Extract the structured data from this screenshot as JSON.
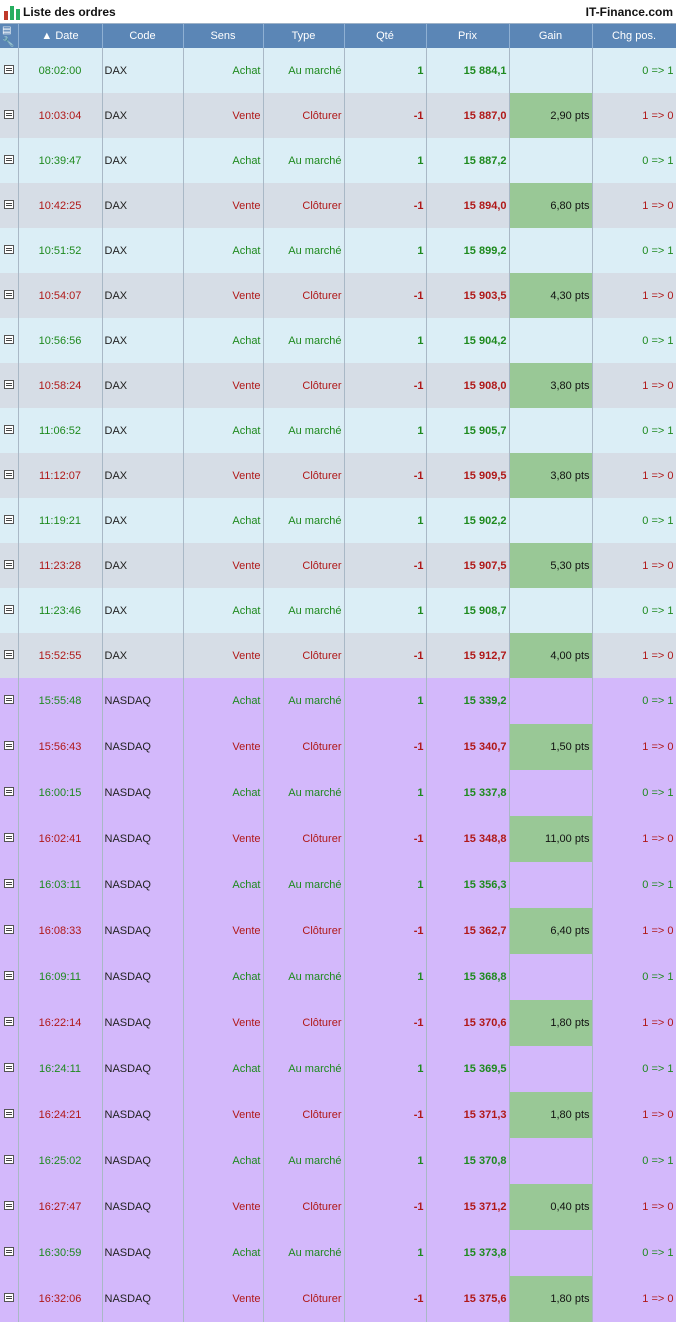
{
  "window": {
    "title": "Liste des ordres",
    "brand": "IT-Finance.com"
  },
  "icons": {
    "app": "candlestick-chart-icon",
    "header_doc": "document-icon",
    "header_tool": "wrench-icon",
    "sort": "sort-up-arrow-icon",
    "row": "order-detail-icon"
  },
  "colors": {
    "buy": "#1e8a1e",
    "sell": "#b01818",
    "gain_bg": "#99c896",
    "header_bg": "#5b86b6",
    "dax_row": "#dbeef6",
    "dax_row_alt": "#d6dde6",
    "nasdaq_row": "#d3b8fb"
  },
  "columns": {
    "date": "Date",
    "code": "Code",
    "sens": "Sens",
    "type": "Type",
    "qte": "Qté",
    "prix": "Prix",
    "gain": "Gain",
    "chg": "Chg pos."
  },
  "orders": [
    {
      "date": "08:02:00",
      "code": "DAX",
      "sens": "Achat",
      "type": "Au marché",
      "qte": "1",
      "prix": "15 884,1",
      "gain": "",
      "chg": "0 => 1"
    },
    {
      "date": "10:03:04",
      "code": "DAX",
      "sens": "Vente",
      "type": "Clôturer",
      "qte": "-1",
      "prix": "15 887,0",
      "gain": "2,90 pts",
      "chg": "1 => 0"
    },
    {
      "date": "10:39:47",
      "code": "DAX",
      "sens": "Achat",
      "type": "Au marché",
      "qte": "1",
      "prix": "15 887,2",
      "gain": "",
      "chg": "0 => 1"
    },
    {
      "date": "10:42:25",
      "code": "DAX",
      "sens": "Vente",
      "type": "Clôturer",
      "qte": "-1",
      "prix": "15 894,0",
      "gain": "6,80 pts",
      "chg": "1 => 0"
    },
    {
      "date": "10:51:52",
      "code": "DAX",
      "sens": "Achat",
      "type": "Au marché",
      "qte": "1",
      "prix": "15 899,2",
      "gain": "",
      "chg": "0 => 1"
    },
    {
      "date": "10:54:07",
      "code": "DAX",
      "sens": "Vente",
      "type": "Clôturer",
      "qte": "-1",
      "prix": "15 903,5",
      "gain": "4,30 pts",
      "chg": "1 => 0"
    },
    {
      "date": "10:56:56",
      "code": "DAX",
      "sens": "Achat",
      "type": "Au marché",
      "qte": "1",
      "prix": "15 904,2",
      "gain": "",
      "chg": "0 => 1"
    },
    {
      "date": "10:58:24",
      "code": "DAX",
      "sens": "Vente",
      "type": "Clôturer",
      "qte": "-1",
      "prix": "15 908,0",
      "gain": "3,80 pts",
      "chg": "1 => 0"
    },
    {
      "date": "11:06:52",
      "code": "DAX",
      "sens": "Achat",
      "type": "Au marché",
      "qte": "1",
      "prix": "15 905,7",
      "gain": "",
      "chg": "0 => 1"
    },
    {
      "date": "11:12:07",
      "code": "DAX",
      "sens": "Vente",
      "type": "Clôturer",
      "qte": "-1",
      "prix": "15 909,5",
      "gain": "3,80 pts",
      "chg": "1 => 0"
    },
    {
      "date": "11:19:21",
      "code": "DAX",
      "sens": "Achat",
      "type": "Au marché",
      "qte": "1",
      "prix": "15 902,2",
      "gain": "",
      "chg": "0 => 1"
    },
    {
      "date": "11:23:28",
      "code": "DAX",
      "sens": "Vente",
      "type": "Clôturer",
      "qte": "-1",
      "prix": "15 907,5",
      "gain": "5,30 pts",
      "chg": "1 => 0"
    },
    {
      "date": "11:23:46",
      "code": "DAX",
      "sens": "Achat",
      "type": "Au marché",
      "qte": "1",
      "prix": "15 908,7",
      "gain": "",
      "chg": "0 => 1"
    },
    {
      "date": "15:52:55",
      "code": "DAX",
      "sens": "Vente",
      "type": "Clôturer",
      "qte": "-1",
      "prix": "15 912,7",
      "gain": "4,00 pts",
      "chg": "1 => 0"
    },
    {
      "date": "15:55:48",
      "code": "NASDAQ",
      "sens": "Achat",
      "type": "Au marché",
      "qte": "1",
      "prix": "15 339,2",
      "gain": "",
      "chg": "0 => 1"
    },
    {
      "date": "15:56:43",
      "code": "NASDAQ",
      "sens": "Vente",
      "type": "Clôturer",
      "qte": "-1",
      "prix": "15 340,7",
      "gain": "1,50 pts",
      "chg": "1 => 0"
    },
    {
      "date": "16:00:15",
      "code": "NASDAQ",
      "sens": "Achat",
      "type": "Au marché",
      "qte": "1",
      "prix": "15 337,8",
      "gain": "",
      "chg": "0 => 1"
    },
    {
      "date": "16:02:41",
      "code": "NASDAQ",
      "sens": "Vente",
      "type": "Clôturer",
      "qte": "-1",
      "prix": "15 348,8",
      "gain": "11,00 pts",
      "chg": "1 => 0"
    },
    {
      "date": "16:03:11",
      "code": "NASDAQ",
      "sens": "Achat",
      "type": "Au marché",
      "qte": "1",
      "prix": "15 356,3",
      "gain": "",
      "chg": "0 => 1"
    },
    {
      "date": "16:08:33",
      "code": "NASDAQ",
      "sens": "Vente",
      "type": "Clôturer",
      "qte": "-1",
      "prix": "15 362,7",
      "gain": "6,40 pts",
      "chg": "1 => 0"
    },
    {
      "date": "16:09:11",
      "code": "NASDAQ",
      "sens": "Achat",
      "type": "Au marché",
      "qte": "1",
      "prix": "15 368,8",
      "gain": "",
      "chg": "0 => 1"
    },
    {
      "date": "16:22:14",
      "code": "NASDAQ",
      "sens": "Vente",
      "type": "Clôturer",
      "qte": "-1",
      "prix": "15 370,6",
      "gain": "1,80 pts",
      "chg": "1 => 0"
    },
    {
      "date": "16:24:11",
      "code": "NASDAQ",
      "sens": "Achat",
      "type": "Au marché",
      "qte": "1",
      "prix": "15 369,5",
      "gain": "",
      "chg": "0 => 1"
    },
    {
      "date": "16:24:21",
      "code": "NASDAQ",
      "sens": "Vente",
      "type": "Clôturer",
      "qte": "-1",
      "prix": "15 371,3",
      "gain": "1,80 pts",
      "chg": "1 => 0"
    },
    {
      "date": "16:25:02",
      "code": "NASDAQ",
      "sens": "Achat",
      "type": "Au marché",
      "qte": "1",
      "prix": "15 370,8",
      "gain": "",
      "chg": "0 => 1"
    },
    {
      "date": "16:27:47",
      "code": "NASDAQ",
      "sens": "Vente",
      "type": "Clôturer",
      "qte": "-1",
      "prix": "15 371,2",
      "gain": "0,40 pts",
      "chg": "1 => 0"
    },
    {
      "date": "16:30:59",
      "code": "NASDAQ",
      "sens": "Achat",
      "type": "Au marché",
      "qte": "1",
      "prix": "15 373,8",
      "gain": "",
      "chg": "0 => 1"
    },
    {
      "date": "16:32:06",
      "code": "NASDAQ",
      "sens": "Vente",
      "type": "Clôturer",
      "qte": "-1",
      "prix": "15 375,6",
      "gain": "1,80 pts",
      "chg": "1 => 0"
    }
  ]
}
